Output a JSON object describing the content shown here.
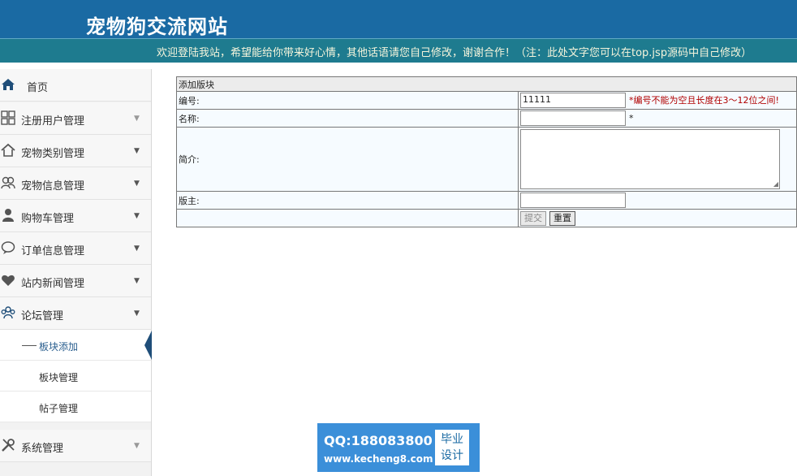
{
  "header": {
    "site_title": "宠物狗交流网站",
    "marquee": "欢迎登陆我站，希望能给你带来好心情，其他话语请您自己修改，谢谢合作！（注：此处文字您可以在top.jsp源码中自己修改）"
  },
  "sidebar": {
    "home": "首页",
    "items": [
      {
        "label": "注册用户管理",
        "icon": "grid-icon"
      },
      {
        "label": "宠物类别管理",
        "icon": "home-icon"
      },
      {
        "label": "宠物信息管理",
        "icon": "users-icon"
      },
      {
        "label": "购物车管理",
        "icon": "user-icon"
      },
      {
        "label": "订单信息管理",
        "icon": "chat-icon"
      },
      {
        "label": "站内新闻管理",
        "icon": "heart-icon"
      },
      {
        "label": "论坛管理",
        "icon": "group-icon"
      }
    ],
    "sub_items": [
      {
        "label": "板块添加"
      },
      {
        "label": "板块管理"
      },
      {
        "label": "帖子管理"
      }
    ],
    "system": "系统管理"
  },
  "form": {
    "caption": "添加版块",
    "code_label": "编号:",
    "code_value": "11111",
    "code_error": "*编号不能为空且长度在3～12位之间!",
    "name_label": "名称:",
    "name_required": "*",
    "intro_label": "简介:",
    "owner_label": "版主:",
    "submit_label": "提交",
    "reset_label": "重置"
  },
  "watermark": {
    "qq": "QQ:188083800",
    "url": "www.kecheng8.com",
    "badge_line1": "毕业",
    "badge_line2": "设计"
  }
}
